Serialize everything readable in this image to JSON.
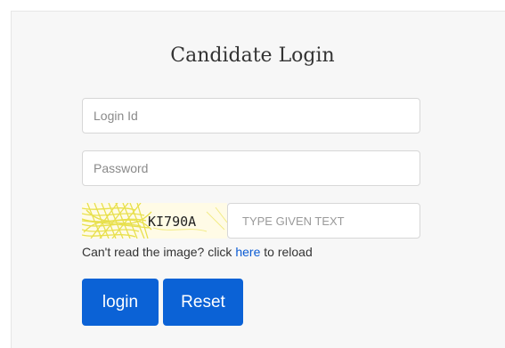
{
  "login_form": {
    "title": "Candidate Login",
    "login_id": {
      "value": "",
      "placeholder": "Login Id"
    },
    "password": {
      "value": "",
      "placeholder": "Password"
    },
    "captcha": {
      "image_text": "KI790A",
      "input_placeholder": "TYPE GIVEN TEXT",
      "input_value": ""
    },
    "reload": {
      "prefix": "Can't read the image? click ",
      "link": "here",
      "suffix": " to reload"
    },
    "buttons": {
      "login": "login",
      "reset": "Reset"
    }
  },
  "colors": {
    "primary": "#0b62d6",
    "link": "#0b5bd3",
    "card_bg": "#f7f7f7",
    "captcha_bg": "#fffbe6"
  }
}
